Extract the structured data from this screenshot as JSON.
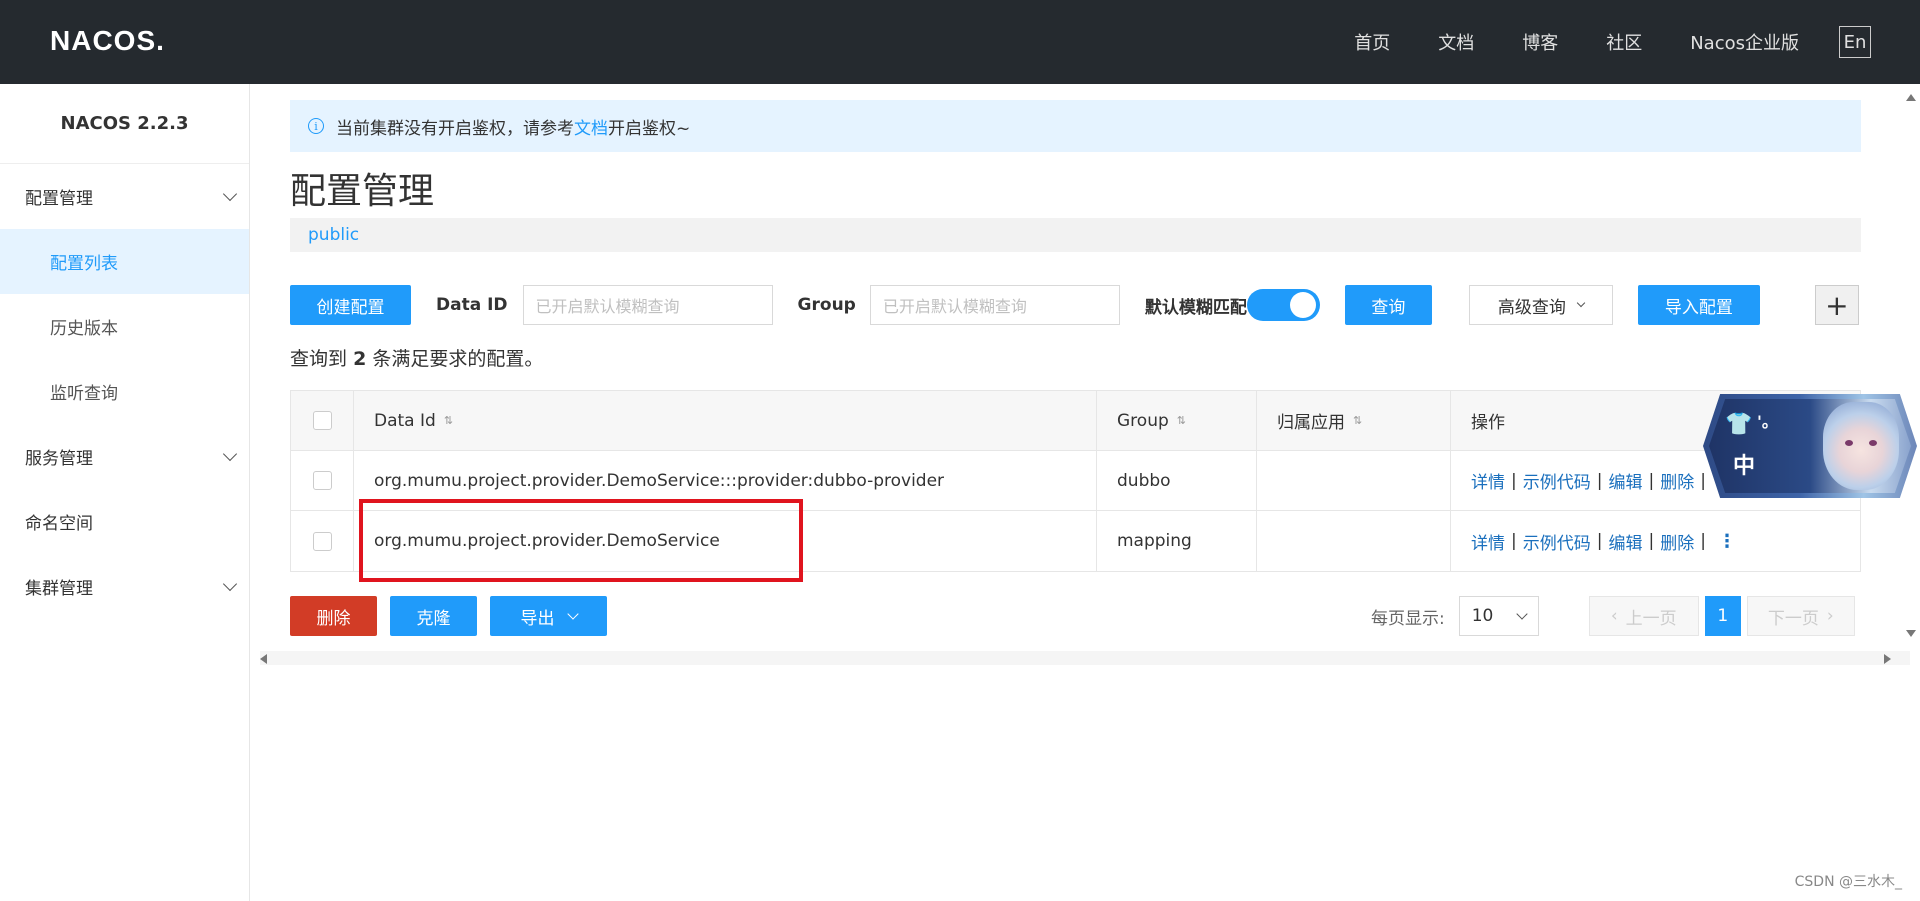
{
  "header": {
    "logo": "NACOS.",
    "nav": [
      "首页",
      "文档",
      "博客",
      "社区",
      "Nacos企业版"
    ],
    "lang": "En"
  },
  "sidebar": {
    "version": "NACOS 2.2.3",
    "groups": [
      {
        "label": "配置管理",
        "items": [
          "配置列表",
          "历史版本",
          "监听查询"
        ]
      },
      {
        "label": "服务管理"
      },
      {
        "label": "命名空间"
      },
      {
        "label": "集群管理"
      }
    ]
  },
  "notice": {
    "prefix": "当前集群没有开启鉴权，请参考",
    "link": "文档",
    "suffix": "开启鉴权~"
  },
  "page": {
    "title": "配置管理",
    "namespace": "public"
  },
  "toolbar": {
    "create": "创建配置",
    "data_id_label": "Data ID",
    "data_id_placeholder": "已开启默认模糊查询",
    "group_label": "Group",
    "group_placeholder": "已开启默认模糊查询",
    "fuzzy_label": "默认模糊匹配",
    "fuzzy_on": true,
    "query": "查询",
    "advanced": "高级查询",
    "import": "导入配置",
    "plus": "+"
  },
  "result": {
    "prefix": "查询到",
    "count": "2",
    "suffix": "条满足要求的配置。"
  },
  "table": {
    "headers": {
      "data_id": "Data Id",
      "group": "Group",
      "app": "归属应用",
      "ops": "操作"
    },
    "rows": [
      {
        "data_id": "org.mumu.project.provider.DemoService:::provider:dubbo-provider",
        "group": "dubbo",
        "app": ""
      },
      {
        "data_id": "org.mumu.project.provider.DemoService",
        "group": "mapping",
        "app": ""
      }
    ],
    "ops": {
      "detail": "详情",
      "sample": "示例代码",
      "edit": "编辑",
      "delete": "删除",
      "sep": "|",
      "more": "⋮"
    }
  },
  "bottom": {
    "delete": "删除",
    "clone": "克隆",
    "export": "导出",
    "page_size_label": "每页显示:",
    "page_size": "10",
    "prev": "上一页",
    "current_page": "1",
    "next": "下一页"
  },
  "ime": {
    "zh": "中",
    "dots": "'。"
  },
  "watermark": "CSDN @三水木_",
  "colors": {
    "accent": "#209bfa",
    "danger": "#d23c26",
    "header_bg": "#252a2f",
    "highlight": "#e0141e"
  }
}
